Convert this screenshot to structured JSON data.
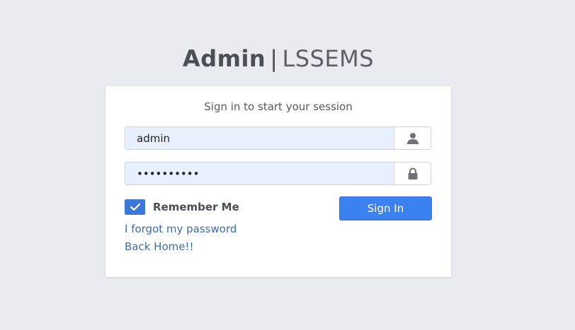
{
  "header": {
    "brand_strong": "Admin",
    "separator": "|",
    "brand_light": "LSSEMS"
  },
  "login": {
    "message": "Sign in to start your session",
    "username": {
      "value": "admin",
      "icon": "user-icon"
    },
    "password": {
      "value": "hidden-9ch",
      "icon": "lock-icon"
    },
    "remember_label": "Remember Me",
    "remember_checked": true,
    "submit_label": "Sign In",
    "forgot_link": "I forgot my password",
    "home_link": "Back Home!!"
  },
  "colors": {
    "background": "#e9ebf0",
    "accent": "#3b82f0",
    "link": "#3a6db5",
    "input_fill": "#e8f0fe"
  }
}
